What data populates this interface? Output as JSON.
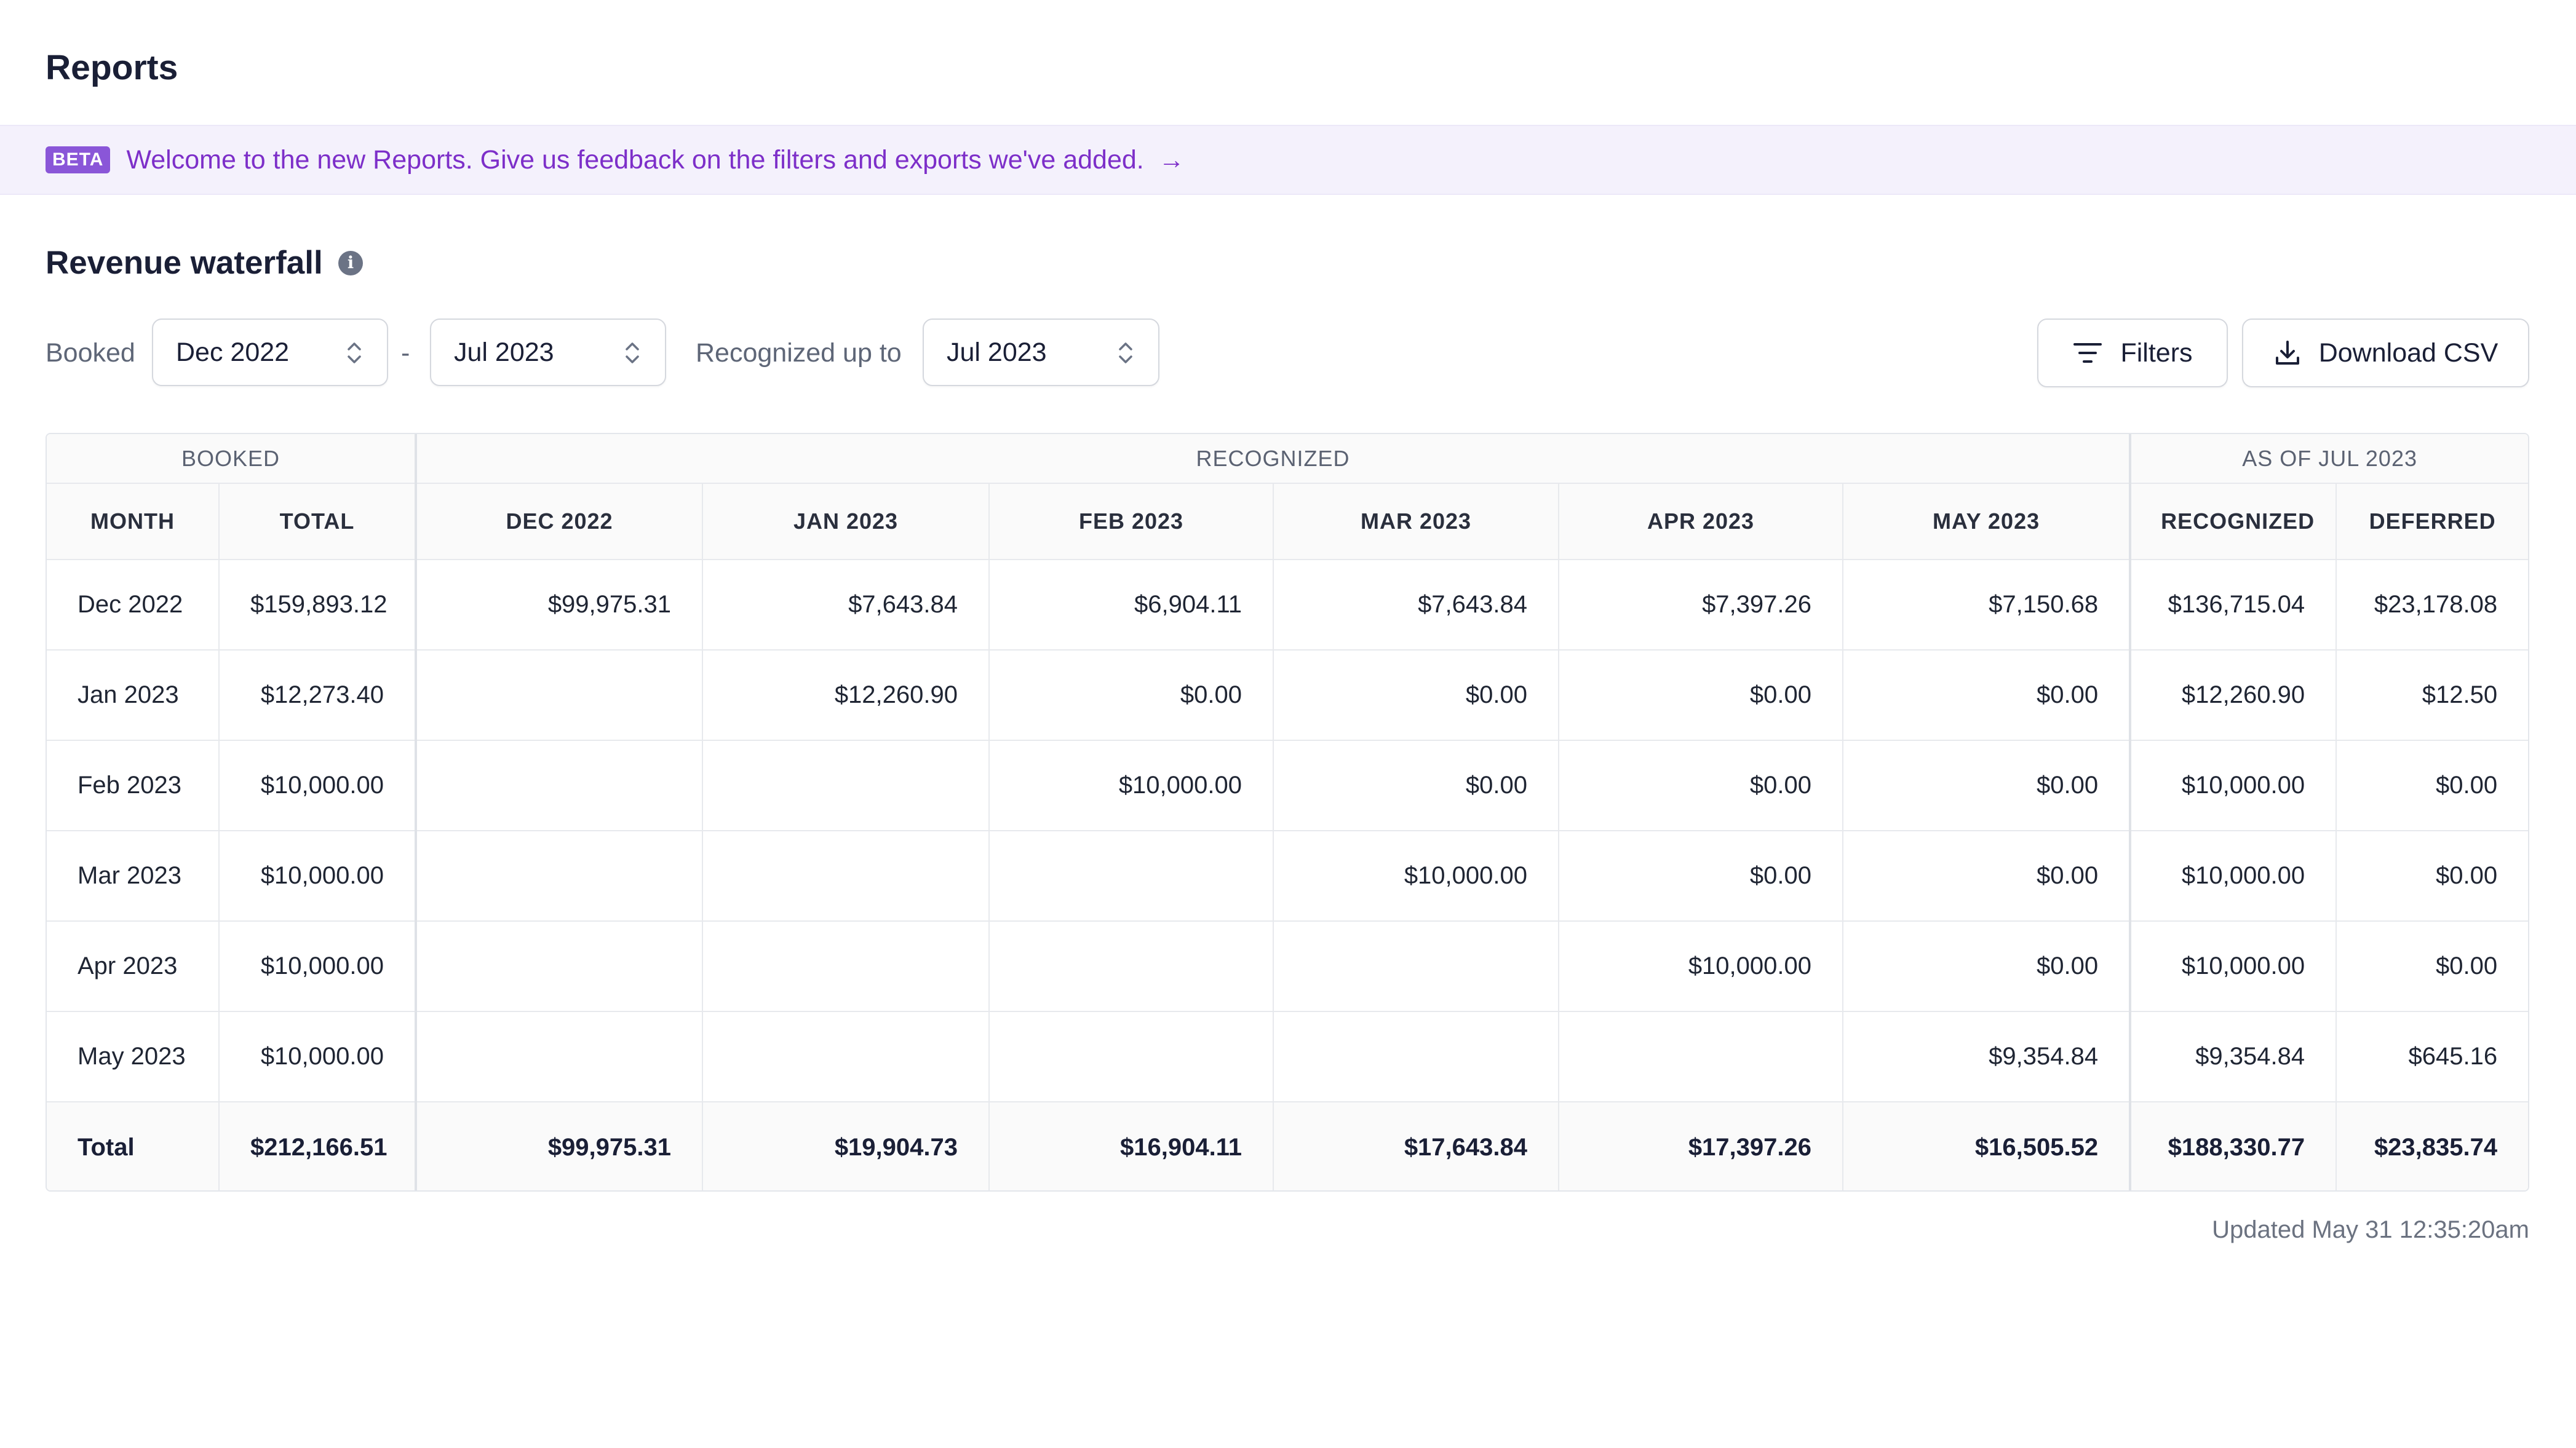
{
  "page": {
    "title": "Reports"
  },
  "banner": {
    "badge": "BETA",
    "text": "Welcome to the new Reports. Give us feedback on the filters and exports we've added.",
    "arrow": "→"
  },
  "section": {
    "title": "Revenue waterfall",
    "info_icon": "i"
  },
  "controls": {
    "booked_label": "Booked",
    "booked_from": "Dec 2022",
    "separator": "-",
    "booked_to": "Jul 2023",
    "recognized_label": "Recognized up to",
    "recognized_to": "Jul 2023",
    "filters_label": "Filters",
    "download_label": "Download CSV"
  },
  "table": {
    "groups": {
      "booked": "BOOKED",
      "recognized": "RECOGNIZED",
      "as_of": "AS OF JUL 2023"
    },
    "columns": [
      "MONTH",
      "TOTAL",
      "DEC 2022",
      "JAN 2023",
      "FEB 2023",
      "MAR 2023",
      "APR 2023",
      "MAY 2023",
      "RECOGNIZED",
      "DEFERRED"
    ],
    "rows": [
      [
        "Dec 2022",
        "$159,893.12",
        "$99,975.31",
        "$7,643.84",
        "$6,904.11",
        "$7,643.84",
        "$7,397.26",
        "$7,150.68",
        "$136,715.04",
        "$23,178.08"
      ],
      [
        "Jan 2023",
        "$12,273.40",
        "",
        "$12,260.90",
        "$0.00",
        "$0.00",
        "$0.00",
        "$0.00",
        "$12,260.90",
        "$12.50"
      ],
      [
        "Feb 2023",
        "$10,000.00",
        "",
        "",
        "$10,000.00",
        "$0.00",
        "$0.00",
        "$0.00",
        "$10,000.00",
        "$0.00"
      ],
      [
        "Mar 2023",
        "$10,000.00",
        "",
        "",
        "",
        "$10,000.00",
        "$0.00",
        "$0.00",
        "$10,000.00",
        "$0.00"
      ],
      [
        "Apr 2023",
        "$10,000.00",
        "",
        "",
        "",
        "",
        "$10,000.00",
        "$0.00",
        "$10,000.00",
        "$0.00"
      ],
      [
        "May 2023",
        "$10,000.00",
        "",
        "",
        "",
        "",
        "",
        "$9,354.84",
        "$9,354.84",
        "$645.16"
      ]
    ],
    "total": [
      "Total",
      "$212,166.51",
      "$99,975.31",
      "$19,904.73",
      "$16,904.11",
      "$17,643.84",
      "$17,397.26",
      "$16,505.52",
      "$188,330.77",
      "$23,835.74"
    ]
  },
  "footer": {
    "updated": "Updated May 31 12:35:20am"
  },
  "colors": {
    "accent": "#7d2fc9",
    "badge": "#8a56d8",
    "banner_bg": "#f4f1fc"
  }
}
